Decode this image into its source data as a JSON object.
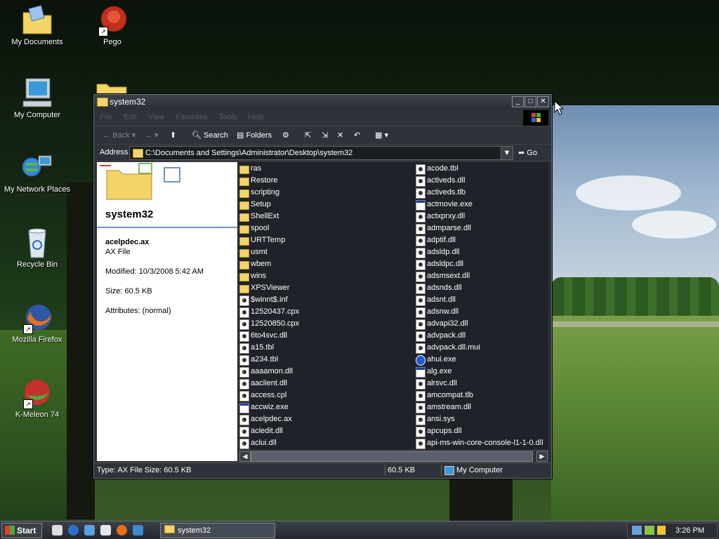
{
  "desktop": {
    "icons": [
      {
        "label": "My Documents",
        "icon": "my-documents-icon"
      },
      {
        "label": "Pego",
        "icon": "pego-icon"
      },
      {
        "label": "My Computer",
        "icon": "my-computer-icon"
      },
      {
        "label": "My Network Places",
        "icon": "network-places-icon"
      },
      {
        "label": "Recycle Bin",
        "icon": "recycle-bin-icon"
      },
      {
        "label": "Mozilla Firefox",
        "icon": "firefox-icon"
      },
      {
        "label": "K-Meleon 74",
        "icon": "k-meleon-icon"
      }
    ]
  },
  "window": {
    "title": "system32",
    "menu": [
      "File",
      "Edit",
      "View",
      "Favorites",
      "Tools",
      "Help"
    ],
    "toolbar": {
      "back": "Back",
      "search": "Search",
      "folders": "Folders"
    },
    "address": {
      "label": "Address",
      "value": "C:\\Documents and Settings\\Administrator\\Desktop\\system32",
      "go": "Go"
    },
    "details": {
      "folder_title": "system32",
      "file_name": "acelpdec.ax",
      "file_type": "AX File",
      "modified": "Modified: 10/3/2008 5:42 AM",
      "size": "Size: 60.5 KB",
      "attributes": "Attributes: (normal)"
    },
    "files_col1": [
      {
        "name": "ras",
        "kind": "folder"
      },
      {
        "name": "Restore",
        "kind": "folder"
      },
      {
        "name": "scripting",
        "kind": "folder"
      },
      {
        "name": "Setup",
        "kind": "folder"
      },
      {
        "name": "ShellExt",
        "kind": "folder"
      },
      {
        "name": "spool",
        "kind": "folder"
      },
      {
        "name": "URTTemp",
        "kind": "folder"
      },
      {
        "name": "usmt",
        "kind": "folder"
      },
      {
        "name": "wbem",
        "kind": "folder"
      },
      {
        "name": "wins",
        "kind": "folder"
      },
      {
        "name": "XPSViewer",
        "kind": "folder"
      },
      {
        "name": "$winnt$.inf",
        "kind": "file"
      },
      {
        "name": "12520437.cpx",
        "kind": "file"
      },
      {
        "name": "12520850.cpx",
        "kind": "file"
      },
      {
        "name": "6to4svc.dll",
        "kind": "file"
      },
      {
        "name": "a15.tbl",
        "kind": "file"
      },
      {
        "name": "a234.tbl",
        "kind": "file"
      },
      {
        "name": "aaaamon.dll",
        "kind": "file"
      },
      {
        "name": "aaclient.dll",
        "kind": "file"
      },
      {
        "name": "access.cpl",
        "kind": "file"
      },
      {
        "name": "accwiz.exe",
        "kind": "exe"
      },
      {
        "name": "acelpdec.ax",
        "kind": "file"
      },
      {
        "name": "acledit.dll",
        "kind": "file"
      },
      {
        "name": "aclui.dll",
        "kind": "file"
      }
    ],
    "files_col2": [
      {
        "name": "acode.tbl",
        "kind": "file"
      },
      {
        "name": "activeds.dll",
        "kind": "file"
      },
      {
        "name": "activeds.tlb",
        "kind": "file"
      },
      {
        "name": "actmovie.exe",
        "kind": "exe"
      },
      {
        "name": "actxprxy.dll",
        "kind": "file"
      },
      {
        "name": "admparse.dll",
        "kind": "file"
      },
      {
        "name": "adptif.dll",
        "kind": "file"
      },
      {
        "name": "adsldp.dll",
        "kind": "file"
      },
      {
        "name": "adsldpc.dll",
        "kind": "file"
      },
      {
        "name": "adsmsext.dll",
        "kind": "file"
      },
      {
        "name": "adsnds.dll",
        "kind": "file"
      },
      {
        "name": "adsnt.dll",
        "kind": "file"
      },
      {
        "name": "adsnw.dll",
        "kind": "file"
      },
      {
        "name": "advapi32.dll",
        "kind": "file"
      },
      {
        "name": "advpack.dll",
        "kind": "file"
      },
      {
        "name": "advpack.dll.mui",
        "kind": "file"
      },
      {
        "name": "ahui.exe",
        "kind": "info"
      },
      {
        "name": "alg.exe",
        "kind": "exe"
      },
      {
        "name": "alrsvc.dll",
        "kind": "file"
      },
      {
        "name": "amcompat.tlb",
        "kind": "file"
      },
      {
        "name": "amstream.dll",
        "kind": "file"
      },
      {
        "name": "ansi.sys",
        "kind": "file"
      },
      {
        "name": "apcups.dll",
        "kind": "file"
      },
      {
        "name": "api-ms-win-core-console-l1-1-0.dll",
        "kind": "file"
      }
    ],
    "status": {
      "type_size": "Type: AX File Size: 60.5 KB",
      "size": "60.5 KB",
      "zone": "My Computer"
    }
  },
  "taskbar": {
    "start": "Start",
    "task": "system32",
    "clock": "3:26 PM"
  }
}
